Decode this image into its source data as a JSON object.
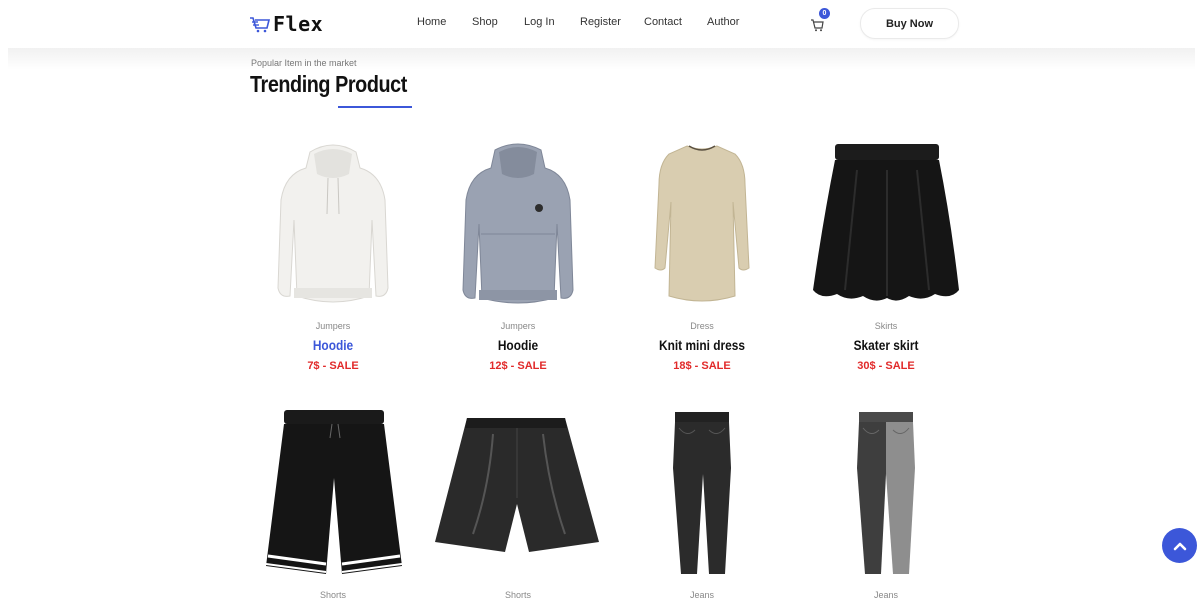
{
  "header": {
    "logo_text": "Flex",
    "nav": [
      "Home",
      "Shop",
      "Log In",
      "Register",
      "Contact",
      "Author"
    ],
    "cart_count": "0",
    "buy_button": "Buy Now"
  },
  "section": {
    "subtitle": "Popular Item in the market",
    "title": "Trending Product"
  },
  "products": [
    {
      "category": "Jumpers",
      "name": "Hoodie",
      "price": "7$ - SALE"
    },
    {
      "category": "Jumpers",
      "name": "Hoodie",
      "price": "12$ - SALE"
    },
    {
      "category": "Dress",
      "name": "Knit mini dress",
      "price": "18$ - SALE"
    },
    {
      "category": "Skirts",
      "name": "Skater skirt",
      "price": "30$ - SALE"
    },
    {
      "category": "Shorts"
    },
    {
      "category": "Shorts"
    },
    {
      "category": "Jeans"
    },
    {
      "category": "Jeans"
    }
  ],
  "colors": {
    "accent": "#3c57d9",
    "price": "#e12a2a"
  }
}
